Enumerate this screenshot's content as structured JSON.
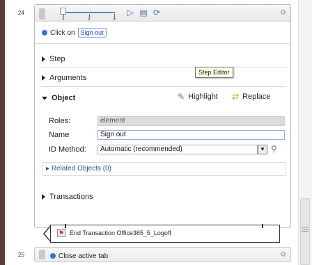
{
  "steps": [
    {
      "number": "24",
      "slider_ticks": [
        "1",
        "2",
        "3"
      ],
      "toolbar_icons": [
        "play-step-icon",
        "play-from-icon",
        "record-icon",
        "gear-icon"
      ],
      "action": {
        "verb": "Click on",
        "target": "Sign out"
      },
      "sections": {
        "step": "Step",
        "arguments": "Arguments",
        "object": "Object"
      },
      "tooltip": "Step Editor",
      "object": {
        "highlight_label": "Highlight",
        "replace_label": "Replace",
        "roles_label": "Roles:",
        "roles_value": "element",
        "name_label": "Name",
        "name_value": "Sign out",
        "id_method_label": "ID Method:",
        "id_method_value": "Automatic (recommended)"
      },
      "related_objects": "Related Objects (0)",
      "transactions": "Transactions",
      "end_transaction": "End Transaction Office365_5_Logoff"
    },
    {
      "number": "25",
      "action": {
        "text": "Close active tab"
      }
    }
  ],
  "colors": {
    "accent": "#3a6fd8",
    "left_border": "#5a3f38",
    "readonly_bg": "#dcdcdc"
  }
}
